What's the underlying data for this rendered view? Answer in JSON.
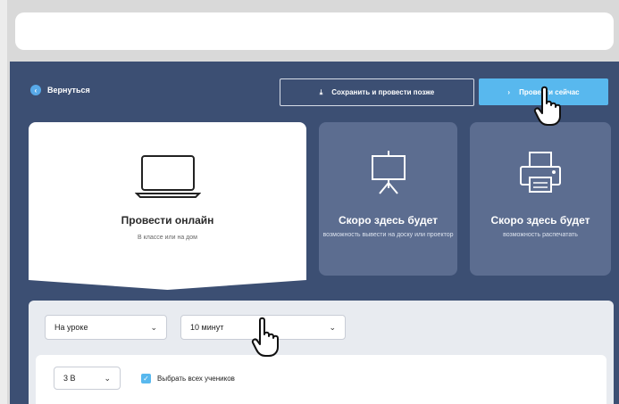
{
  "header": {
    "back_label": "Вернуться",
    "save_later_label": "Сохранить и провести позже",
    "run_now_label": "Провести сейчас"
  },
  "cards": [
    {
      "title": "Провести онлайн",
      "subtitle": "В классе или на дом"
    },
    {
      "title": "Скоро здесь будет",
      "subtitle": "возможность вывести на доску или проектор"
    },
    {
      "title": "Скоро здесь будет",
      "subtitle": "возможность распечатать"
    }
  ],
  "settings": {
    "mode": "На уроке",
    "duration": "10 минут",
    "class": "3 В",
    "select_all_label": "Выбрать всех учеников"
  },
  "colors": {
    "background": "#3c4f73",
    "accent": "#58b8ee"
  }
}
